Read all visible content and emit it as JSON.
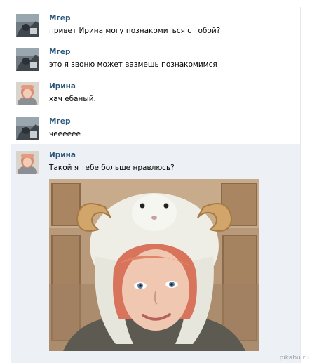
{
  "messages": [
    {
      "author": "Мгер",
      "text": "привет Ирина могу познакомиться с тобой?",
      "avatar": "male-avatar"
    },
    {
      "author": "Мгер",
      "text": "это я звоню может вазмешь познакомимся",
      "avatar": "male-avatar"
    },
    {
      "author": "Ирина",
      "text": "хач ебаный.",
      "avatar": "female-avatar"
    },
    {
      "author": "Мгер",
      "text": "чееееее",
      "avatar": "male-avatar"
    },
    {
      "author": "Ирина",
      "text": "Такой я тебе больше нравлюсь?",
      "avatar": "female-avatar",
      "has_photo": true
    }
  ],
  "watermark": "pikabu.ru",
  "colors": {
    "author_link": "#2b587a",
    "highlight_bg": "#edf1f5",
    "border": "#e4e8ee"
  }
}
